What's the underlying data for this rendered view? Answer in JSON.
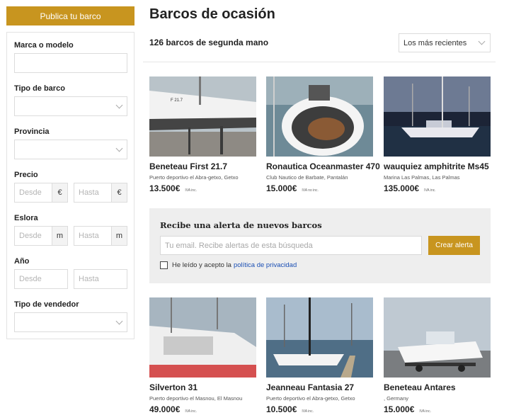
{
  "sidebar": {
    "publish_label": "Publica tu barco",
    "filters": {
      "brand": {
        "label": "Marca o modelo"
      },
      "type": {
        "label": "Tipo de barco"
      },
      "province": {
        "label": "Provincia"
      },
      "price": {
        "label": "Precio",
        "from_placeholder": "Desde",
        "to_placeholder": "Hasta",
        "unit": "€"
      },
      "length": {
        "label": "Eslora",
        "from_placeholder": "Desde",
        "to_placeholder": "Hasta",
        "unit": "m"
      },
      "year": {
        "label": "Año",
        "from_placeholder": "Desde",
        "to_placeholder": "Hasta"
      },
      "seller": {
        "label": "Tipo de vendedor"
      }
    }
  },
  "main": {
    "title": "Barcos de ocasión",
    "count": "126 barcos de segunda mano",
    "sort_value": "Los más recientes",
    "listings": [
      {
        "title": "Beneteau First 21.7",
        "location": "Puerto deportivo el Abra-getxo, Getxo",
        "price": "13.500€",
        "vat": "IVA inc."
      },
      {
        "title": "Ronautica Oceanmaster 470",
        "location": "Club Nautico de Barbate, Pantalán",
        "price": "15.000€",
        "vat": "IVA no inc."
      },
      {
        "title": "wauquiez amphitrite Ms45",
        "location": "Marina Las Palmas, Las Palmas",
        "price": "135.000€",
        "vat": "IVA inc."
      },
      {
        "title": "Silverton 31",
        "location": "Puerto deportivo el Masnou, El Masnou",
        "price": "49.000€",
        "vat": "IVA inc."
      },
      {
        "title": "Jeanneau Fantasia 27",
        "location": "Puerto deportivo el Abra-getxo, Getxo",
        "price": "10.500€",
        "vat": "IVA inc."
      },
      {
        "title": "Beneteau Antares",
        "location": ", Germany",
        "price": "15.000€",
        "vat": "IVA inc."
      }
    ],
    "alert": {
      "title": "Recibe una alerta de nuevos barcos",
      "email_placeholder": "Tu email. Recibe alertas de esta búsqueda",
      "button": "Crear alerta",
      "consent_text": "He leído y acepto la",
      "policy_link": "política de privacidad"
    }
  },
  "colors": {
    "accent": "#c8951f",
    "link": "#1a4fb4",
    "alert_bg": "#eeeeee"
  },
  "icons": {
    "select_arrow": "chevron-down-icon"
  }
}
